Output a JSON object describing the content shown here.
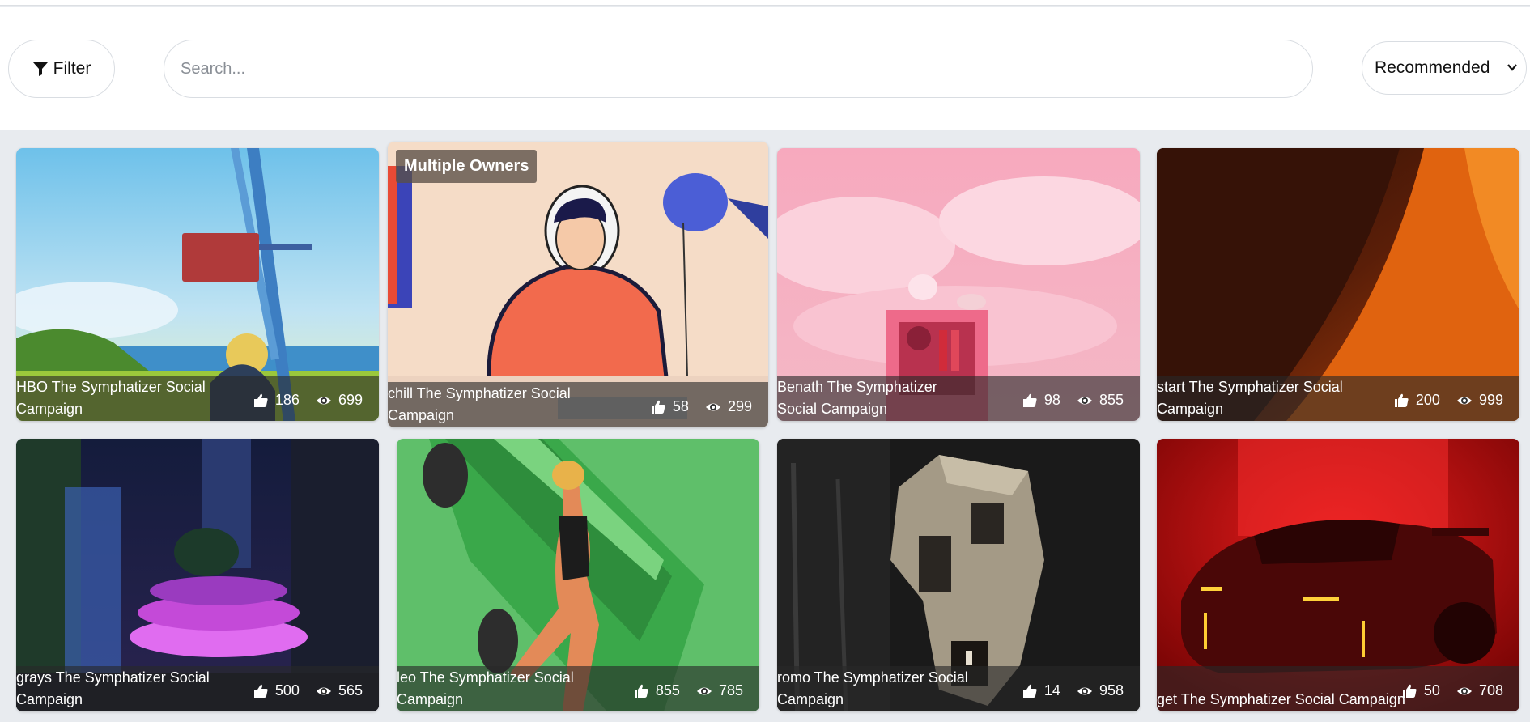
{
  "toolbar": {
    "filter_label": "Filter",
    "search_placeholder": "Search...",
    "sort_selected": "Recommended"
  },
  "cards": [
    {
      "title": "HBO The Symphatizer Social Campaign",
      "likes": "186",
      "views": "699"
    },
    {
      "title": "chill The Symphatizer Social Campaign",
      "likes": "58",
      "views": "299",
      "badge": "Multiple Owners"
    },
    {
      "title": "Benath The Symphatizer Social Campaign",
      "likes": "98",
      "views": "855"
    },
    {
      "title": "start The Symphatizer Social Campaign",
      "likes": "200",
      "views": "999"
    },
    {
      "title": "grays The Symphatizer Social Campaign",
      "likes": "500",
      "views": "565"
    },
    {
      "title": "leo The Symphatizer Social Campaign",
      "likes": "855",
      "views": "785"
    },
    {
      "title": "romo The Symphatizer Social Campaign",
      "likes": "14",
      "views": "958"
    },
    {
      "title": "get The Symphatizer Social Campaign",
      "likes": "50",
      "views": "708"
    }
  ],
  "icons": {
    "filter": "funnel-icon",
    "sort": "chevron-down-icon",
    "likes": "thumbs-up-icon",
    "views": "eye-icon"
  }
}
